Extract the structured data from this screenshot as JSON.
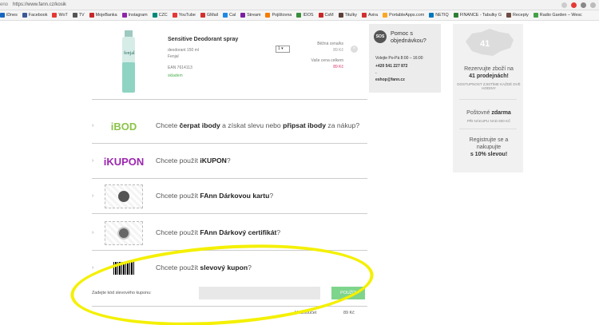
{
  "browser": {
    "url_prefix": "eno",
    "url": "https://www.fann.cz/kosik",
    "bookmarks": [
      {
        "label": "iDnes",
        "color": "#1565c0"
      },
      {
        "label": "Facebook",
        "color": "#3b5998"
      },
      {
        "label": "WoT",
        "color": "#e53935"
      },
      {
        "label": "TV",
        "color": "#555555"
      },
      {
        "label": "MojeBanka",
        "color": "#c62828"
      },
      {
        "label": "Instagram",
        "color": "#8e24aa"
      },
      {
        "label": "CZC",
        "color": "#00897b"
      },
      {
        "label": "YouTube",
        "color": "#e53935"
      },
      {
        "label": "GMail",
        "color": "#d32f2f"
      },
      {
        "label": "Cal",
        "color": "#1e88e5"
      },
      {
        "label": "Stream",
        "color": "#7b1fa2"
      },
      {
        "label": "Pojištovna",
        "color": "#f57c00"
      },
      {
        "label": "IDOS",
        "color": "#388e3c"
      },
      {
        "label": "CsM",
        "color": "#c62828"
      },
      {
        "label": "Titulky",
        "color": "#5d4037"
      },
      {
        "label": "Avira",
        "color": "#d32f2f"
      },
      {
        "label": "PortableApps.com",
        "color": "#f9a825"
      },
      {
        "label": "NETIQ",
        "color": "#0277bd"
      },
      {
        "label": "FINANCE - Tabulky G",
        "color": "#2e7d32"
      },
      {
        "label": "Recepty",
        "color": "#6d4c41"
      },
      {
        "label": "Radio Garden – Wesc",
        "color": "#43a047"
      }
    ]
  },
  "product": {
    "name": "Sensitive Deodorant spray",
    "desc": "deodorant 150 ml",
    "brand": "Fenjal",
    "ean": "EAN 7614113",
    "stock": "skladem",
    "qty": "1",
    "unit_price_label": "Běžná cena/ks",
    "unit_price": "89 Kč",
    "total_label": "Vaše cena celkem",
    "total_price": "89 Kč",
    "bottle_brand": "fenjal"
  },
  "options": [
    {
      "logo": "iBOD",
      "pre": "Chcete ",
      "b1": "čerpat ibody",
      "mid": " a získat slevu nebo ",
      "b2": "připsat ibody",
      "post": " za nákup?"
    },
    {
      "logo": "iKUPON",
      "pre": "Chcete použít ",
      "b1": "iKUPON",
      "mid": "",
      "b2": "",
      "post": "?"
    },
    {
      "pre": "Chcete použít ",
      "b1": "FAnn Dárkovou kartu",
      "mid": "",
      "b2": "",
      "post": "?"
    },
    {
      "pre": "Chcete použít ",
      "b1": "FAnn Dárkový certifikát",
      "mid": "",
      "b2": "",
      "post": "?"
    },
    {
      "pre": "Chcete použít ",
      "b1": "slevový kupon",
      "mid": "",
      "b2": "",
      "post": "?"
    }
  ],
  "coupon": {
    "label": "Zadejte kód slevového kuponu:",
    "button": "POUŽÍT"
  },
  "subtotal": {
    "label": "Mezisoučet",
    "value": "89 Kč"
  },
  "help": {
    "badge": "SOS",
    "title": "Pomoc s objednávkou?",
    "hours": "Volejte Po-Pá 8:00 – 16:00",
    "phone": "+420 541 227 872",
    "dash": "-",
    "email": "eshop@fann.cz"
  },
  "sidebar": {
    "map_number": "41",
    "reserve_pre": "Rezervujte zboží na",
    "reserve_b": "41 prodejnách!",
    "reserve_small": "DOSTUPNOST ZJISTÍME KAŽDÉ DVĚ HODINY",
    "ship_pre": "Poštovné ",
    "ship_b": "zdarma",
    "ship_small": "PŘI NÁKUPU NAD 600 KČ",
    "reg_pre": "Registrujte se a nakupujte",
    "reg_b": "s 10% slevou!"
  }
}
